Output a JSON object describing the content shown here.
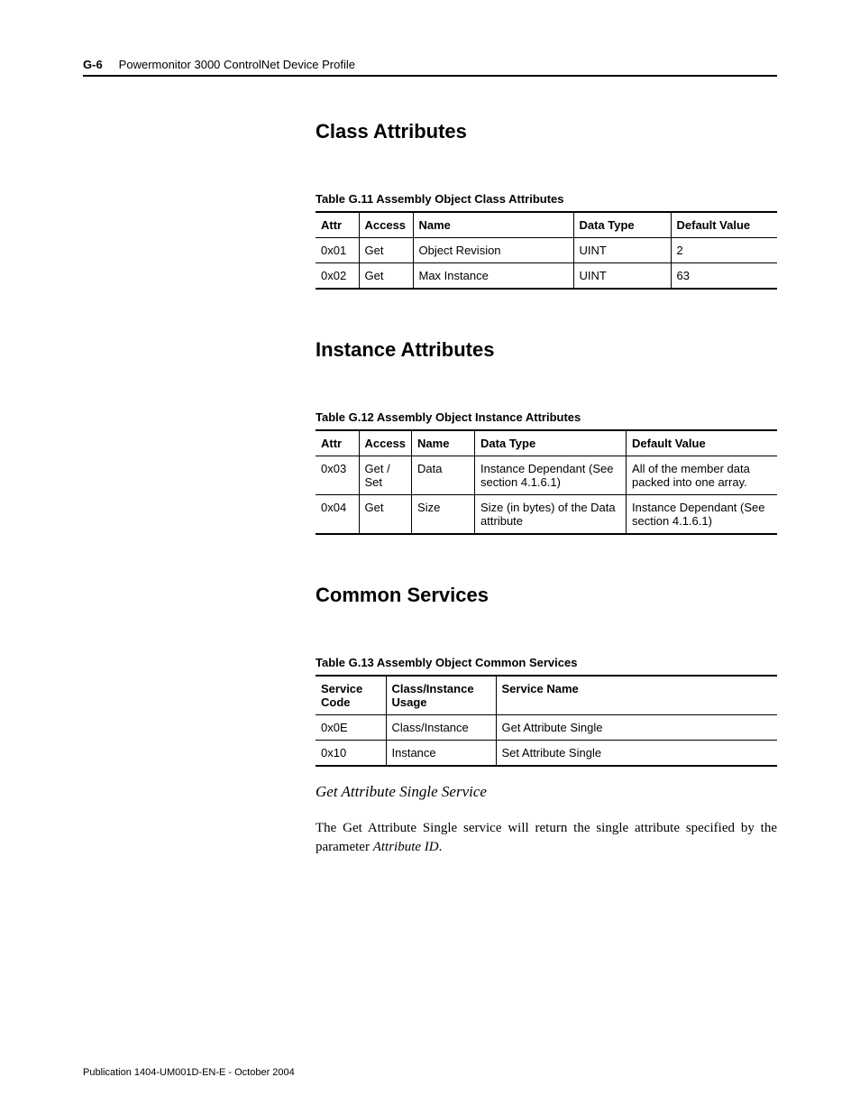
{
  "header": {
    "page_number": "G-6",
    "doc_title": "Powermonitor 3000 ControlNet Device Profile"
  },
  "sections": {
    "class_attributes": {
      "heading": "Class Attributes",
      "table_caption": "Table G.11 Assembly Object Class Attributes",
      "columns": {
        "attr": "Attr",
        "access": "Access",
        "name": "Name",
        "data_type": "Data Type",
        "default": "Default Value"
      },
      "rows": [
        {
          "attr": "0x01",
          "access": "Get",
          "name": "Object Revision",
          "data_type": "UINT",
          "default": "2"
        },
        {
          "attr": "0x02",
          "access": "Get",
          "name": "Max Instance",
          "data_type": "UINT",
          "default": "63"
        }
      ]
    },
    "instance_attributes": {
      "heading": "Instance Attributes",
      "table_caption": "Table G.12 Assembly Object Instance Attributes",
      "columns": {
        "attr": "Attr",
        "access": "Access",
        "name": "Name",
        "data_type": "Data Type",
        "default": "Default Value"
      },
      "rows": [
        {
          "attr": "0x03",
          "access": "Get / Set",
          "name": "Data",
          "data_type": "Instance Dependant (See section 4.1.6.1)",
          "default": "All of the member data packed into one array."
        },
        {
          "attr": "0x04",
          "access": "Get",
          "name": "Size",
          "data_type": "Size (in bytes) of the Data attribute",
          "default": "Instance Dependant (See section 4.1.6.1)"
        }
      ]
    },
    "common_services": {
      "heading": "Common Services",
      "table_caption": "Table G.13 Assembly Object Common Services",
      "columns": {
        "code": "Service Code",
        "usage": "Class/Instance Usage",
        "name": "Service Name"
      },
      "rows": [
        {
          "code": "0x0E",
          "usage": "Class/Instance",
          "name": "Get Attribute Single"
        },
        {
          "code": "0x10",
          "usage": "Instance",
          "name": "Set Attribute Single"
        }
      ],
      "sub_heading": "Get Attribute Single Service",
      "body_prefix": "The Get Attribute Single service will return the single attribute specified by the parameter ",
      "body_em": "Attribute ID",
      "body_suffix": "."
    }
  },
  "footer": "Publication 1404-UM001D-EN-E - October 2004"
}
